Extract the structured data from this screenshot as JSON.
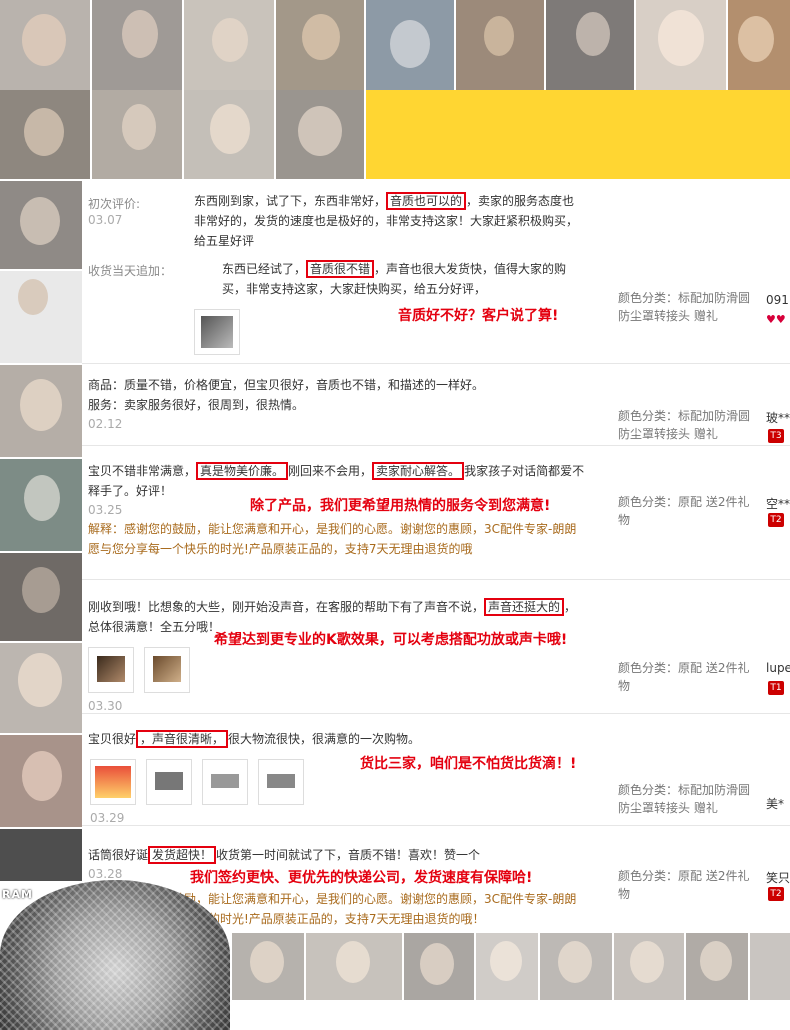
{
  "reviews": [
    {
      "first_label": "初次评价:",
      "first_date": "03.07",
      "first_text_a": "东西刚到家，试了下，东西非常好，",
      "first_hl": "音质也可以的",
      "first_text_b": "，卖家的服务态度也非常好的，发货的速度也是极好的，非常支持这家！大家赶紧积极购买，给五星好评",
      "append_label": "收货当天追加：",
      "append_text_a": "东西已经试了，",
      "append_hl": "音质很不错",
      "append_text_b": "，声音也很大发货快，值得大家的购买，非常支持这家，大家赶快购买，给五分好评，",
      "promo": "音质好不好？客户说了算!",
      "spec": "颜色分类：标配加防滑圆防尘罩转接头 赠礼",
      "buyer": "091"
    },
    {
      "goods": "商品：质量不错，价格便宜，但宝贝很好，音质也不错，和描述的一样好。",
      "service": "服务：卖家服务很好，很周到，很热情。",
      "date": "02.12",
      "spec": "颜色分类：标配加防滑圆防尘罩转接头 赠礼",
      "buyer": "玻**",
      "badge": "T3"
    },
    {
      "text_a": "宝贝不错非常满意，",
      "hl1": "真是物美价廉。",
      "text_b": "刚回来不会用，",
      "hl2": "卖家耐心解答。",
      "text_c": "我家孩子对话简都爱不释手了。好评！",
      "promo": "除了产品，我们更希望用热情的服务令到您满意!",
      "date": "03.25",
      "reply": "解释：感谢您的鼓励，能让您满意和开心，是我们的心愿。谢谢您的惠顾，3C配件专家-朗朗愿与您分享每一个快乐的时光!产品原装正品的，支持7天无理由退货的哦",
      "spec": "颜色分类：原配 送2件礼物",
      "buyer": "空**",
      "badge": "T2"
    },
    {
      "text_a": "刚收到哦！比想象的大些，刚开始没声音，在客服的帮助下有了声音不说，",
      "hl": "声音还挺大的",
      "text_b": "，总体很满意！全五分哦！",
      "promo": "希望达到更专业的K歌效果，可以考虑搭配功放或声卡哦!",
      "date": "03.30",
      "spec": "颜色分类：原配 送2件礼物",
      "buyer": "lupe",
      "badge": "T1"
    },
    {
      "text_a": "宝贝很好",
      "hl": "，声音很清晰，",
      "text_b": "很大物流很快，很满意的一次购物。",
      "promo": "货比三家，咱们是不怕货比货滴！!",
      "date": "03.29",
      "spec": "颜色分类：标配加防滑圆防尘罩转接头 赠礼",
      "buyer": "美*"
    },
    {
      "text_a": "话筒很好诞",
      "hl": "发货超快！",
      "text_b": "收货第一时间就试了下，音质不错！喜欢！赞一个",
      "date": "03.28",
      "promo": "我们签约更快、更优先的快递公司，发货速度有保障哈!",
      "reply": "解释：感谢您的鼓励，能让您满意和开心，是我们的心愿。谢谢您的惠顾，3C配件专家-朗朗愿与您分享每一个快乐的时光!产品原装正品的，支持7天无理由退货的哦！",
      "spec": "颜色分类：原配 送2件礼物",
      "buyer": "笑只",
      "badge": "T2"
    }
  ],
  "overlay": {
    "mic_brand": "RAM"
  }
}
